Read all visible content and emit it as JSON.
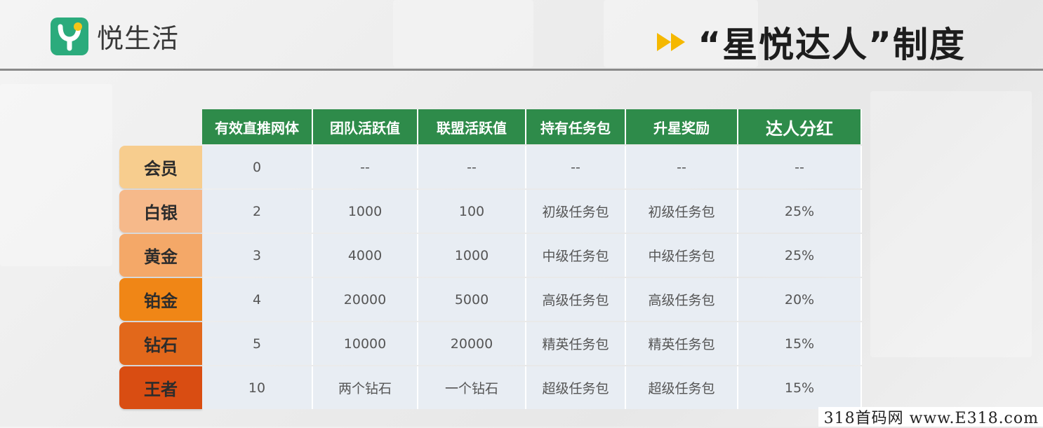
{
  "brand": {
    "name": "悦生活",
    "logo_icon": "yuesh-logo-icon",
    "logo_color": "#2bab7c"
  },
  "title": {
    "text": "“星悦达人”制度",
    "arrow_icon": "double-arrow-icon",
    "arrow_color": "#f5b800"
  },
  "table": {
    "header_color": "#2e8b4a",
    "columns": [
      "有效直推网体",
      "团队活跃值",
      "联盟活跃值",
      "持有任务包",
      "升星奖励",
      "达人分红"
    ],
    "rows": [
      {
        "level": "会员",
        "color": "#f7cd8e",
        "cells": [
          "0",
          "--",
          "--",
          "--",
          "--",
          "--"
        ]
      },
      {
        "level": "白银",
        "color": "#f6b98a",
        "cells": [
          "2",
          "1000",
          "100",
          "初级任务包",
          "初级任务包",
          "25%"
        ]
      },
      {
        "level": "黄金",
        "color": "#f4a868",
        "cells": [
          "3",
          "4000",
          "1000",
          "中级任务包",
          "中级任务包",
          "25%"
        ]
      },
      {
        "level": "铂金",
        "color": "#f08616",
        "cells": [
          "4",
          "20000",
          "5000",
          "高级任务包",
          "高级任务包",
          "20%"
        ]
      },
      {
        "level": "钻石",
        "color": "#e2681b",
        "cells": [
          "5",
          "10000",
          "20000",
          "精英任务包",
          "精英任务包",
          "15%"
        ]
      },
      {
        "level": "王者",
        "color": "#d94d12",
        "cells": [
          "10",
          "两个钻石",
          "一个钻石",
          "超级任务包",
          "超级任务包",
          "15%"
        ]
      }
    ]
  },
  "watermark": "318首码网 www.E318.com"
}
